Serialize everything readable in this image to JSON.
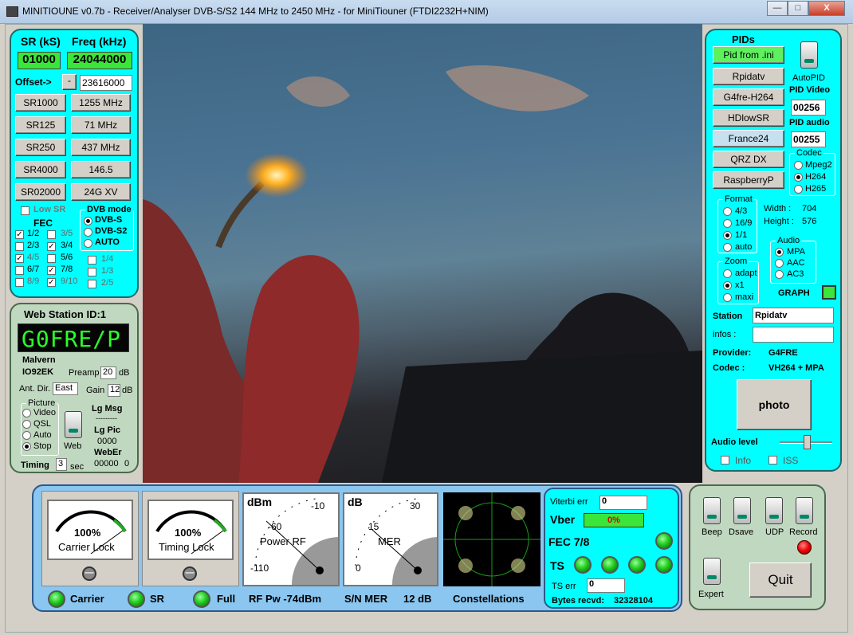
{
  "window": {
    "title": "MINITIOUNE v0.7b - Receiver/Analyser DVB-S/S2 144 MHz to 2450 MHz - for MiniTiouner (FTDI2232H+NIM)",
    "min": "—",
    "max": "□",
    "close": "X"
  },
  "left": {
    "sr_header": "SR (kS)",
    "freq_header": "Freq (kHz)",
    "sr_value": "01000",
    "freq_value": "24044000",
    "offset_label": "Offset->",
    "offset_sign": "-",
    "offset_value": "23616000",
    "sr_buttons": [
      "SR1000",
      "SR125",
      "SR250",
      "SR4000",
      "SR02000"
    ],
    "freq_buttons": [
      "1255 MHz",
      "71 MHz",
      "437 MHz",
      "146.5",
      "24G XV"
    ],
    "low_sr": "Low SR",
    "fec_label": "FEC",
    "dvb_mode_label": "DVB mode",
    "dvb_modes": [
      "DVB-S",
      "DVB-S2",
      "AUTO"
    ],
    "fec_left": [
      "1/2",
      "2/3",
      "4/5",
      "6/7",
      "8/9"
    ],
    "fec_mid": [
      "3/5",
      "3/4",
      "5/6",
      "7/8",
      "9/10"
    ],
    "fec_right": [
      "1/4",
      "1/3",
      "2/5"
    ]
  },
  "station": {
    "title": "Web Station ID:1",
    "callsign": "G0FRE/P",
    "location": "Malvern",
    "locator": "IO92EK",
    "preamp_label": "Preamp",
    "preamp_value": "20",
    "db": "dB",
    "ant_label": "Ant. Dir.",
    "ant_value": "East",
    "gain_label": "Gain",
    "gain_value": "12",
    "picture_label": "Picture",
    "picture_opts": [
      "Video",
      "QSL",
      "Auto",
      "Stop"
    ],
    "web_label": "Web",
    "lg_msg": "Lg Msg",
    "dashes": "---------",
    "lg_pic": "Lg Pic",
    "lg_pic_val": "0000",
    "weber": "WebEr",
    "weber_val": "00000",
    "weber_val2": "0",
    "timing_label": "Timing",
    "timing_value": "3",
    "timing_unit": "sec"
  },
  "right": {
    "pids_title": "PIDs",
    "pid_buttons": [
      "Pid from .ini",
      "Rpidatv",
      "G4fre-H264",
      "HDlowSR",
      "France24",
      "QRZ DX",
      "RaspberryP"
    ],
    "autopid": "AutoPID",
    "pid_video_label": "PID Video",
    "pid_video": "00256",
    "pid_audio_label": "PID audio",
    "pid_audio": "00255",
    "codec_label": "Codec",
    "codecs": [
      "Mpeg2",
      "H264",
      "H265"
    ],
    "format_label": "Format",
    "formats": [
      "4/3",
      "16/9",
      "1/1",
      "auto"
    ],
    "width_label": "Width :",
    "width_val": "704",
    "height_label": "Height :",
    "height_val": "576",
    "audio_label": "Audio",
    "audios": [
      "MPA",
      "AAC",
      "AC3"
    ],
    "zoom_label": "Zoom",
    "zooms": [
      "adapt",
      "x1",
      "maxi"
    ],
    "graph_label": "GRAPH",
    "station_label": "Station",
    "station_value": "Rpidatv",
    "infos_label": "infos :",
    "provider_label": "Provider:",
    "provider_value": "G4FRE",
    "codec_label2": "Codec :",
    "codec_value": "VH264 + MPA",
    "photo": "photo",
    "audio_level": "Audio level",
    "info": "Info",
    "iss": "ISS"
  },
  "bottom": {
    "carrier_lock": "Carrier Lock",
    "timing_lock": "Timing Lock",
    "pct1": "100%",
    "pct2": "100%",
    "power_unit": "dBm",
    "power_ticks": [
      "-10",
      "-60",
      "-110"
    ],
    "power_label": "Power RF",
    "mer_unit": "dB",
    "mer_ticks": [
      "30",
      "15",
      "0"
    ],
    "mer_label": "MER",
    "carrier": "Carrier",
    "sr": "SR",
    "full": "Full",
    "rf_pw": "RF Pw -74dBm",
    "sn_mer": "S/N MER",
    "mer_val": "12 dB",
    "constellations": "Constellations",
    "viterbi_label": "Viterbi err",
    "viterbi_val": "0",
    "vber_label": "Vber",
    "vber_val": "0%",
    "fec_status": "FEC 7/8",
    "ts_label": "TS",
    "ts_err_label": "TS err",
    "ts_err_val": "0",
    "bytes_label": "Bytes recvd:",
    "bytes_val": "32328104"
  },
  "controls": {
    "beep": "Beep",
    "dsave": "Dsave",
    "udp": "UDP",
    "record": "Record",
    "expert": "Expert",
    "quit": "Quit"
  }
}
